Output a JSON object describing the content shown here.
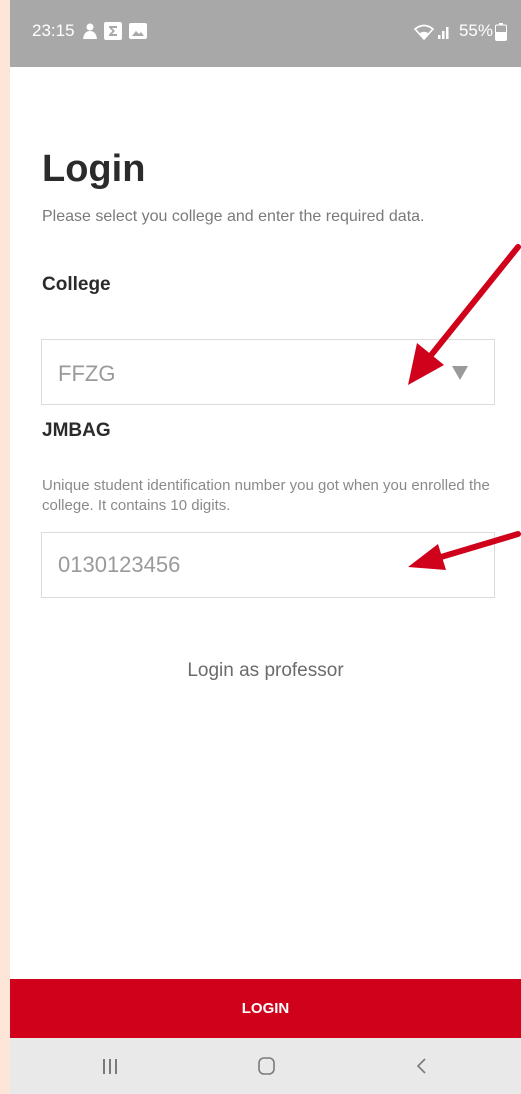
{
  "status_bar": {
    "time": "23:15",
    "battery": "55%"
  },
  "icons": {
    "notification_1": "person-silhouette-icon",
    "notification_2": "sigma-icon",
    "notification_3": "image-icon",
    "wifi": "wifi-icon",
    "signal": "signal-icon",
    "battery": "battery-icon",
    "dropdown": "triangle-down-icon",
    "nav_recent": "recent-apps-icon",
    "nav_home": "home-icon",
    "nav_back": "back-icon"
  },
  "login": {
    "title": "Login",
    "subtitle": "Please select you college and enter the required data."
  },
  "college": {
    "label": "College",
    "selected": "FFZG"
  },
  "jmbag": {
    "label": "JMBAG",
    "help": "Unique student identification number you got when you enrolled the college. It contains 10 digits.",
    "placeholder": "0130123456"
  },
  "professor_link": "Login as professor",
  "login_button": "LOGIN",
  "colors": {
    "accent": "#d0021b",
    "annotation_arrow": "#d0021b",
    "status_bar": "#a8a8a8",
    "page_border": "#fde6d8"
  }
}
